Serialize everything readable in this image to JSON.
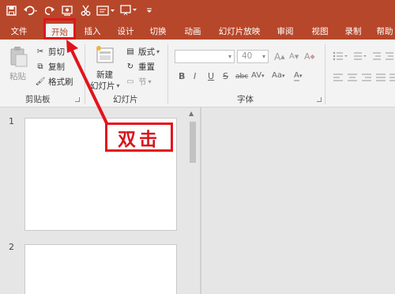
{
  "qat": {
    "save_icon": "save-icon",
    "undo_icon": "undo-icon",
    "redo_icon": "redo-icon",
    "from_beginning_icon": "start-from-beginning-icon",
    "cut_icon": "cut-icon",
    "screenshot_icon": "screenshot-icon",
    "slideshow_icon": "present-icon",
    "customize_icon": "customize-qat-icon"
  },
  "tabs": [
    {
      "label": "文件"
    },
    {
      "label": "开始"
    },
    {
      "label": "插入"
    },
    {
      "label": "设计"
    },
    {
      "label": "切换"
    },
    {
      "label": "动画"
    },
    {
      "label": "幻灯片放映"
    },
    {
      "label": "审阅"
    },
    {
      "label": "视图"
    },
    {
      "label": "录制"
    },
    {
      "label": "帮助"
    }
  ],
  "ribbon": {
    "clipboard": {
      "paste": "粘贴",
      "cut": "剪切",
      "copy": "复制",
      "format_painter": "格式刷",
      "group_label": "剪贴板"
    },
    "slides": {
      "new_slide_line1": "新建",
      "new_slide_line2": "幻灯片",
      "layout": "版式",
      "reset": "重置",
      "section": "节",
      "group_label": "幻灯片"
    },
    "font": {
      "font_name": "",
      "font_size": "40",
      "group_label": "字体",
      "bold": "B",
      "italic": "I",
      "underline": "U",
      "strike": "S",
      "shadow": "abc",
      "spacing": "AV",
      "case": "Aa",
      "grow": "A",
      "shrink": "A",
      "clear": "A"
    }
  },
  "slides": [
    {
      "number": "1"
    },
    {
      "number": "2"
    }
  ],
  "annotation": {
    "text": "双击",
    "color": "#e2141b"
  },
  "colors": {
    "accent": "#b7472a",
    "highlight": "#e2141b"
  }
}
